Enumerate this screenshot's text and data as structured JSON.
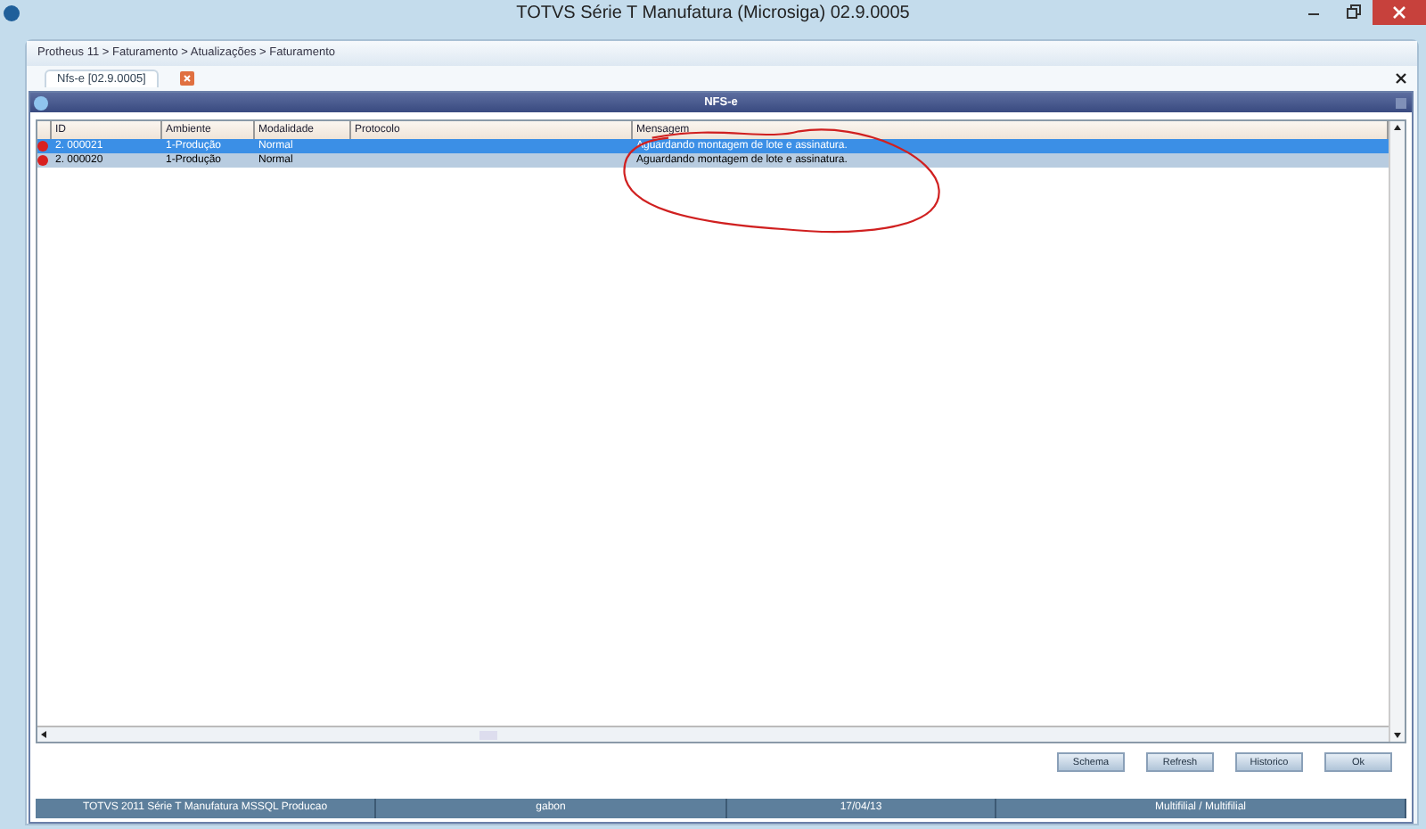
{
  "window": {
    "title": "TOTVS Série T Manufatura (Microsiga) 02.9.0005"
  },
  "breadcrumb": "Protheus 11 > Faturamento > Atualizações > Faturamento",
  "tabs": [
    {
      "label": "Nfs-e [02.9.0005]",
      "selected": true
    }
  ],
  "dialog": {
    "title": "NFS-e",
    "table": {
      "columns": [
        "ID",
        "Ambiente",
        "Modalidade",
        "Protocolo",
        "Mensagem"
      ],
      "rows": [
        {
          "selected": true,
          "cells": [
            "2. 000021",
            "1-Produção",
            "Normal",
            "",
            "Aguardando montagem de lote e assinatura."
          ]
        },
        {
          "selected": false,
          "cells": [
            "2. 000020",
            "1-Produção",
            "Normal",
            "",
            "Aguardando montagem de lote e assinatura."
          ]
        }
      ]
    },
    "buttons": [
      "Schema",
      "Refresh",
      "Historico",
      "Ok"
    ]
  },
  "status_bar": [
    "TOTVS 2011 Série T Manufatura MSSQL Producao",
    "gabon",
    "17/04/13",
    "Multifilial / Multifilial"
  ]
}
